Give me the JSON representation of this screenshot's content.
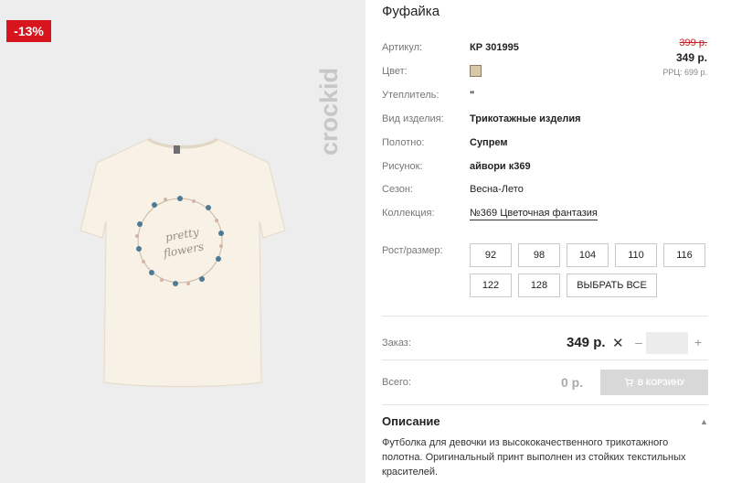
{
  "gallery": {
    "discount_badge": "-13%",
    "brand_logo": "crockid"
  },
  "product": {
    "title": "Фуфайка",
    "attributes": {
      "article_label": "Артикул:",
      "article_value": "КР 301995",
      "color_label": "Цвет:",
      "color_hex": "#d9c8a8",
      "insulation_label": "Утеплитель:",
      "insulation_value": "\"",
      "type_label": "Вид изделия:",
      "type_value": "Трикотажные изделия",
      "fabric_label": "Полотно:",
      "fabric_value": "Супрем",
      "print_label": "Рисунок:",
      "print_value": "айвори к369",
      "season_label": "Сезон:",
      "season_value": "Весна-Лето",
      "collection_label": "Коллекция:",
      "collection_value": "№369 Цветочная фантазия"
    },
    "pricing": {
      "old_price": "399 р.",
      "price": "349 р.",
      "rrp": "РРЦ: 699 р."
    },
    "sizes": {
      "label": "Рост/размер:",
      "options": [
        "92",
        "98",
        "104",
        "110",
        "116",
        "122",
        "128"
      ],
      "select_all": "ВЫБРАТЬ ВСЕ"
    },
    "order": {
      "label": "Заказ:",
      "price": "349 р.",
      "times": "✕",
      "minus": "–",
      "plus": "+",
      "quantity": ""
    },
    "total": {
      "label": "Всего:",
      "value": "0 р.",
      "cart_button": "В КОРЗИНУ"
    },
    "description": {
      "title": "Описание",
      "text": "Футболка для девочки из высококачественного трикотажного полотна. Оригинальный принт выполнен из стойких текстильных красителей."
    }
  }
}
